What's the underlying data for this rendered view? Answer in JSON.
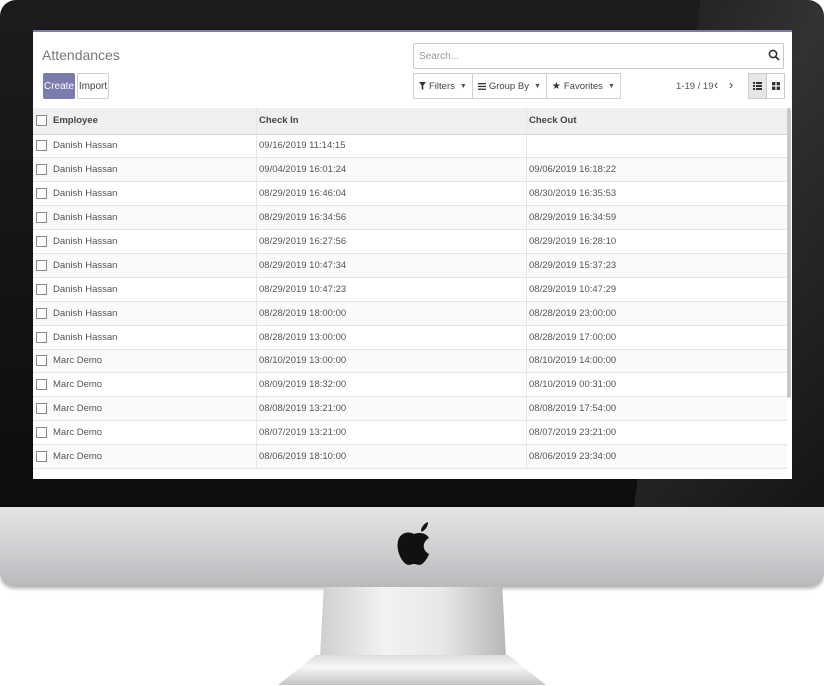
{
  "page": {
    "title": "Attendances",
    "create_label": "Create",
    "import_label": "Import"
  },
  "search": {
    "placeholder": "Search..."
  },
  "filters": {
    "filters_label": "Filters",
    "groupby_label": "Group By",
    "favorites_label": "Favorites"
  },
  "pager": {
    "range": "1-19 / 19"
  },
  "table": {
    "headers": {
      "employee": "Employee",
      "check_in": "Check In",
      "check_out": "Check Out"
    },
    "rows": [
      {
        "employee": "Danish Hassan",
        "check_in": "09/16/2019 11:14:15",
        "check_out": ""
      },
      {
        "employee": "Danish Hassan",
        "check_in": "09/04/2019 16:01:24",
        "check_out": "09/06/2019 16:18:22"
      },
      {
        "employee": "Danish Hassan",
        "check_in": "08/29/2019 16:46:04",
        "check_out": "08/30/2019 16:35:53"
      },
      {
        "employee": "Danish Hassan",
        "check_in": "08/29/2019 16:34:56",
        "check_out": "08/29/2019 16:34:59"
      },
      {
        "employee": "Danish Hassan",
        "check_in": "08/29/2019 16:27:56",
        "check_out": "08/29/2019 16:28:10"
      },
      {
        "employee": "Danish Hassan",
        "check_in": "08/29/2019 10:47:34",
        "check_out": "08/29/2019 15:37:23"
      },
      {
        "employee": "Danish Hassan",
        "check_in": "08/29/2019 10:47:23",
        "check_out": "08/29/2019 10:47:29"
      },
      {
        "employee": "Danish Hassan",
        "check_in": "08/28/2019 18:00:00",
        "check_out": "08/28/2019 23:00:00"
      },
      {
        "employee": "Danish Hassan",
        "check_in": "08/28/2019 13:00:00",
        "check_out": "08/28/2019 17:00:00"
      },
      {
        "employee": "Marc Demo",
        "check_in": "08/10/2019 13:00:00",
        "check_out": "08/10/2019 14:00:00"
      },
      {
        "employee": "Marc Demo",
        "check_in": "08/09/2019 18:32:00",
        "check_out": "08/10/2019 00:31:00"
      },
      {
        "employee": "Marc Demo",
        "check_in": "08/08/2019 13:21:00",
        "check_out": "08/08/2019 17:54:00"
      },
      {
        "employee": "Marc Demo",
        "check_in": "08/07/2019 13:21:00",
        "check_out": "08/07/2019 23:21:00"
      },
      {
        "employee": "Marc Demo",
        "check_in": "08/06/2019 18:10:00",
        "check_out": "08/06/2019 23:34:00"
      }
    ]
  },
  "colors": {
    "accent": "#7c7bad",
    "bezel": "#111111",
    "chin": "#d4d4d6"
  },
  "icons": [
    "search-icon",
    "filter-icon",
    "list-icon",
    "star-icon",
    "chevron-left-icon",
    "chevron-right-icon",
    "list-view-icon",
    "kanban-view-icon",
    "apple-logo-icon"
  ]
}
